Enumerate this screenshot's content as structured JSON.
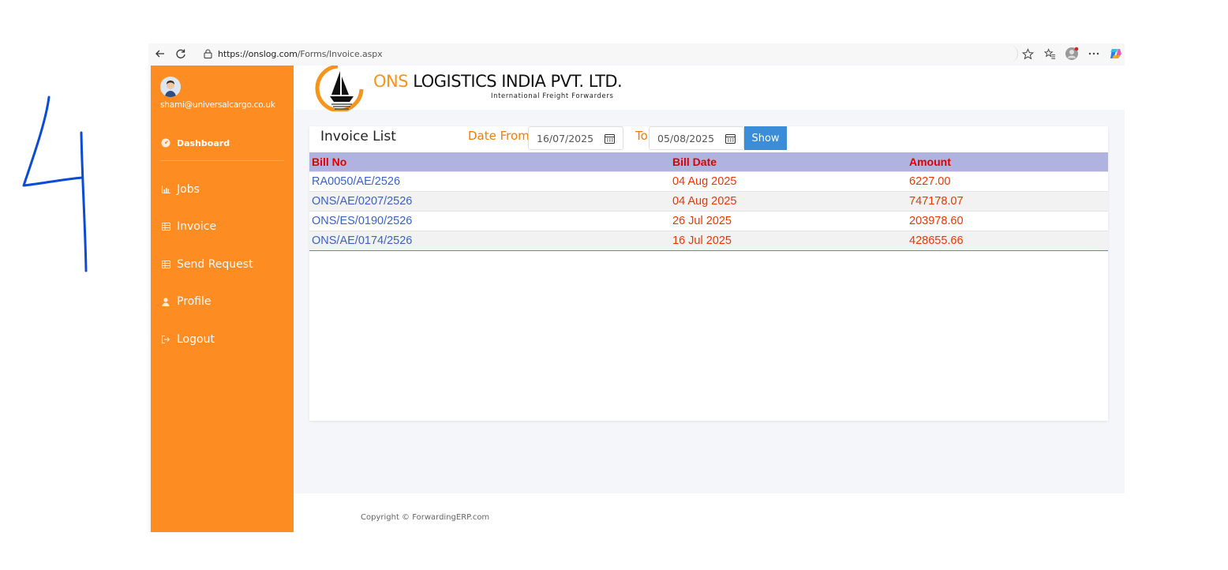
{
  "browser": {
    "url_main": "https://onslog.com",
    "url_path": "/Forms/Invoice.aspx"
  },
  "sidebar": {
    "user_email": "shami@universalcargo.co.uk",
    "dashboard_label": "Dashboard",
    "items": [
      {
        "label": "Jobs",
        "icon": "chart-icon"
      },
      {
        "label": "Invoice",
        "icon": "table-icon"
      },
      {
        "label": "Send Request",
        "icon": "table-icon"
      },
      {
        "label": "Profile",
        "icon": "user-icon"
      },
      {
        "label": "Logout",
        "icon": "sign-out-icon"
      }
    ],
    "color": "#fd8c22"
  },
  "header": {
    "brand_ons": "ONS",
    "brand_rest": "LOGISTICS INDIA PVT. LTD.",
    "tagline": "International Freight Forwarders"
  },
  "invoice": {
    "title": "Invoice List",
    "date_from_label": "Date From",
    "date_from": "16/07/2025",
    "to_label": "To",
    "date_to": "05/08/2025",
    "show_label": "Show",
    "columns": [
      "Bill No",
      "Bill Date",
      "Amount"
    ],
    "rows": [
      {
        "bill_no": "RA0050/AE/2526",
        "bill_date": "04 Aug 2025",
        "amount": "6227.00"
      },
      {
        "bill_no": "ONS/AE/0207/2526",
        "bill_date": "04 Aug 2025",
        "amount": "747178.07"
      },
      {
        "bill_no": "ONS/ES/0190/2526",
        "bill_date": "26 Jul 2025",
        "amount": "203978.60"
      },
      {
        "bill_no": "ONS/AE/0174/2526",
        "bill_date": "16 Jul 2025",
        "amount": "428655.66"
      }
    ]
  },
  "footer": {
    "copyright": "Copyright © ForwardingERP.com"
  }
}
